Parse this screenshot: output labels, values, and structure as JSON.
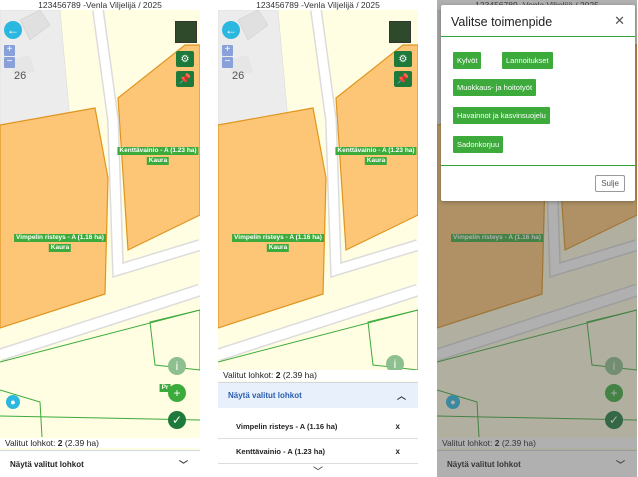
{
  "header": {
    "title": "123456789 -Venla Viljelijä / 2025"
  },
  "map": {
    "house_number": "26",
    "fields": [
      {
        "label": "Kenttävainio - A (1.23 ha)",
        "crop": "Kaura"
      },
      {
        "label": "Vimpelin risteys - A (1.16 ha)",
        "crop": "Kaura"
      }
    ],
    "partial_label": "Pr"
  },
  "icons": {
    "back": "arrow-left-icon",
    "layers": "layer-thumbnail-icon",
    "settings": "gear-icon",
    "pin": "pin-icon",
    "info": "info-icon",
    "add": "plus-icon",
    "confirm": "check-icon",
    "location": "location-pin-icon",
    "zoom_in": "plus-icon",
    "zoom_out": "minus-icon"
  },
  "selection": {
    "label": "Valitut lohkot:",
    "count": "2",
    "area": "(2.39 ha)",
    "toggle_label": "Näytä valitut lohkot",
    "items": [
      {
        "name": "Vimpelin risteys - A (1.16 ha)",
        "remove": "x"
      },
      {
        "name": "Kenttävainio - A (1.23 ha)",
        "remove": "x"
      }
    ]
  },
  "dialog": {
    "title": "Valitse toimenpide",
    "close": "✕",
    "actions": [
      "Kylvöt",
      "Lannoitukset",
      "Muokkaus- ja hoitotyöt",
      "Havainnot ja kasvinsuojelu",
      "Sadonkorjuu"
    ],
    "close_button": "Sulje"
  },
  "colors": {
    "background": "#fffde2",
    "field_fill": "#fdc677",
    "field_stroke": "#e0951f",
    "road": "#ececec",
    "accent_green": "#3cab3c",
    "dark_green": "#1e7a3a",
    "cyan": "#2bb8e0"
  }
}
